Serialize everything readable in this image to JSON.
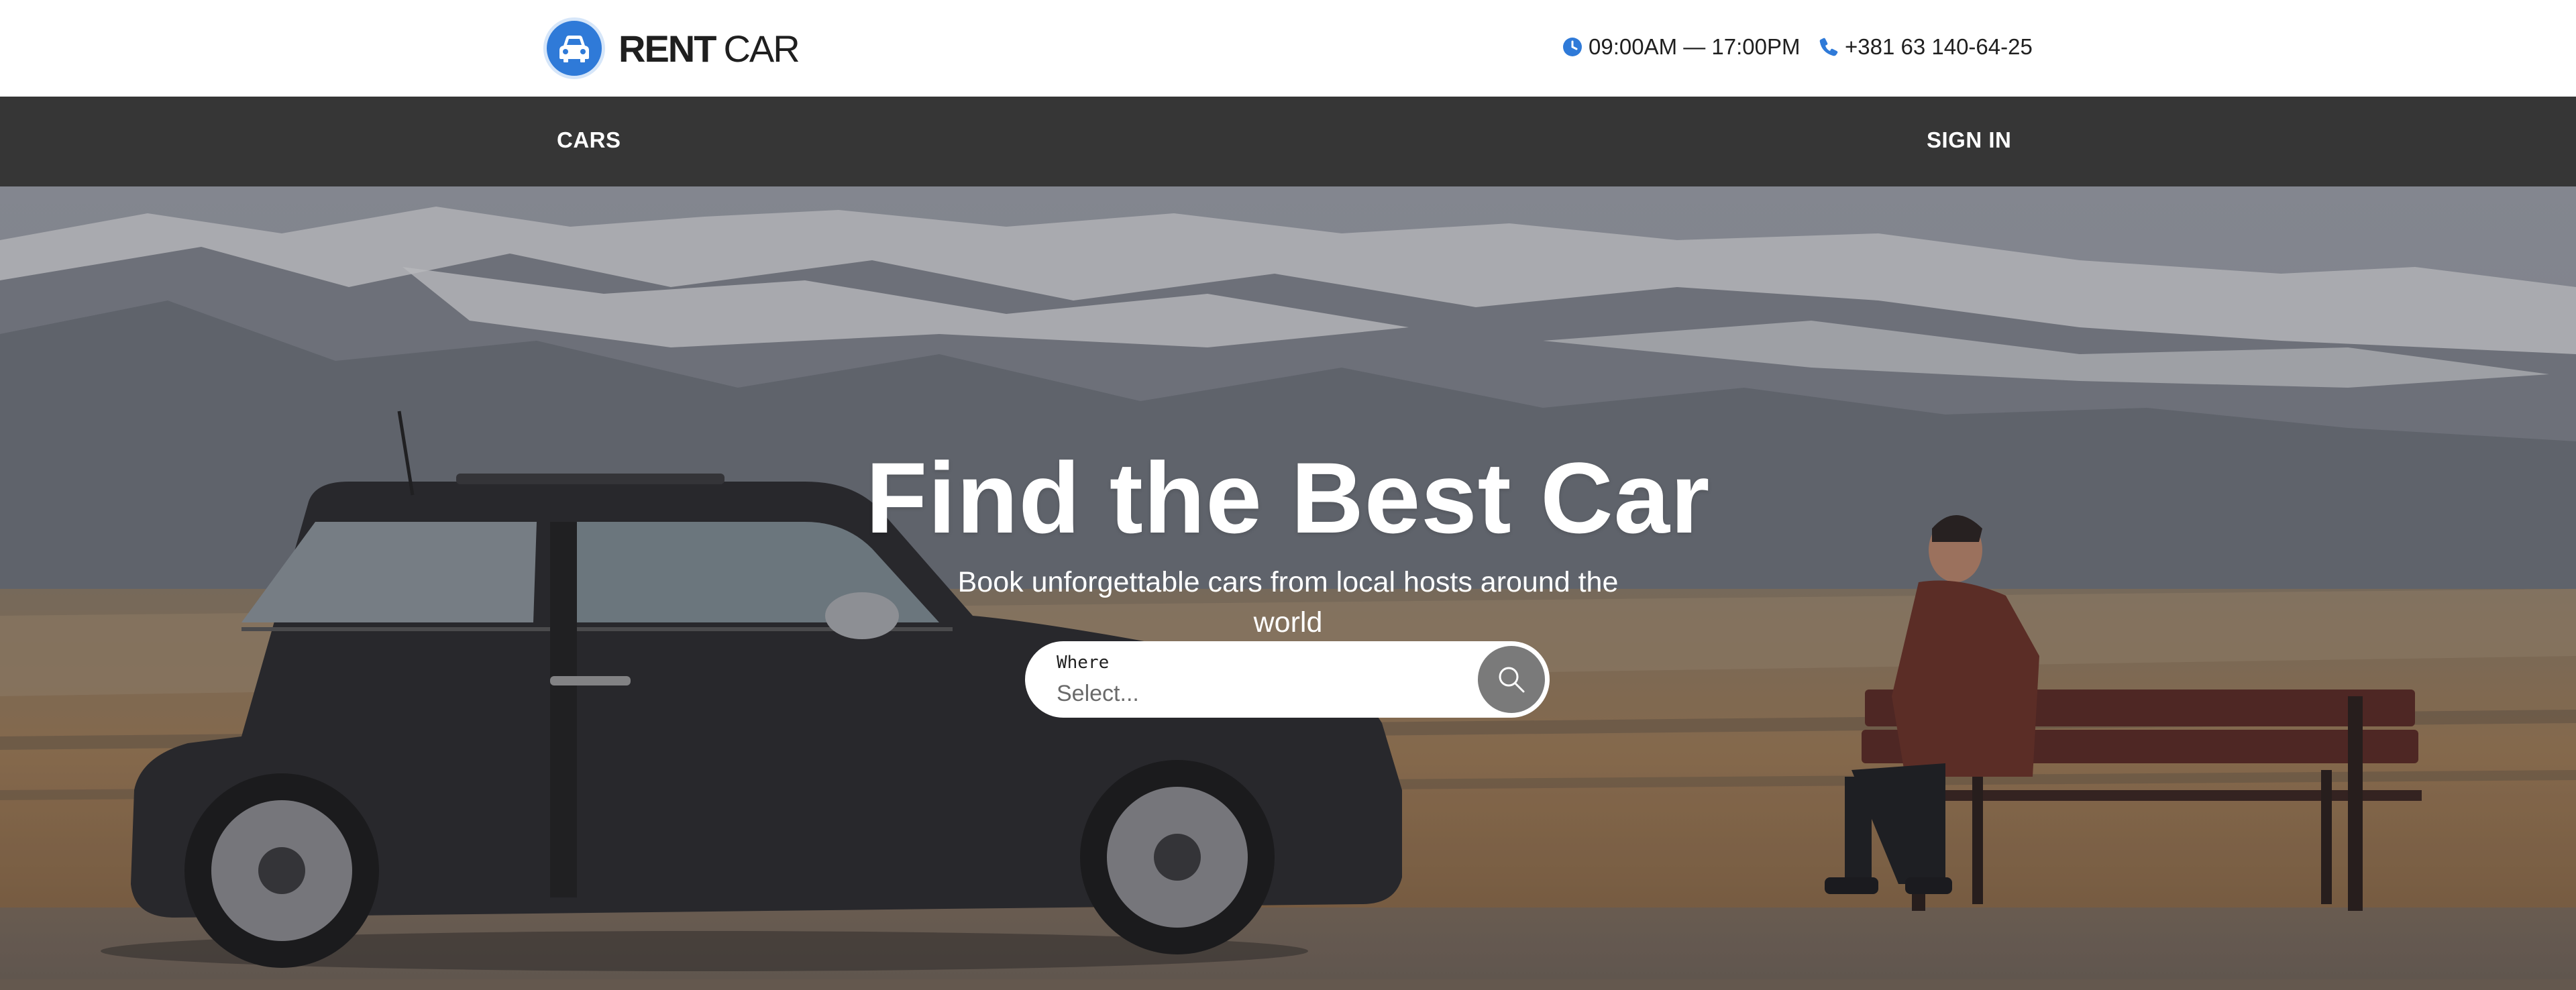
{
  "brand": {
    "name_bold": "RENT",
    "name_light": "CAR",
    "accent": "#2f7ad8",
    "icon": "car-icon"
  },
  "contact": {
    "hours": {
      "icon": "clock-icon",
      "text": "09:00AM — 17:00PM"
    },
    "phone": {
      "icon": "phone-icon",
      "text": "+381 63 140-64-25"
    }
  },
  "nav": {
    "cars_label": "CARS",
    "signin_label": "SIGN IN",
    "background": "#363636"
  },
  "hero": {
    "title": "Find the Best Car",
    "subtitle": "Book unforgettable cars from local hosts around the world"
  },
  "search": {
    "label": "Where",
    "placeholder": "Select...",
    "button_icon": "search-icon"
  }
}
